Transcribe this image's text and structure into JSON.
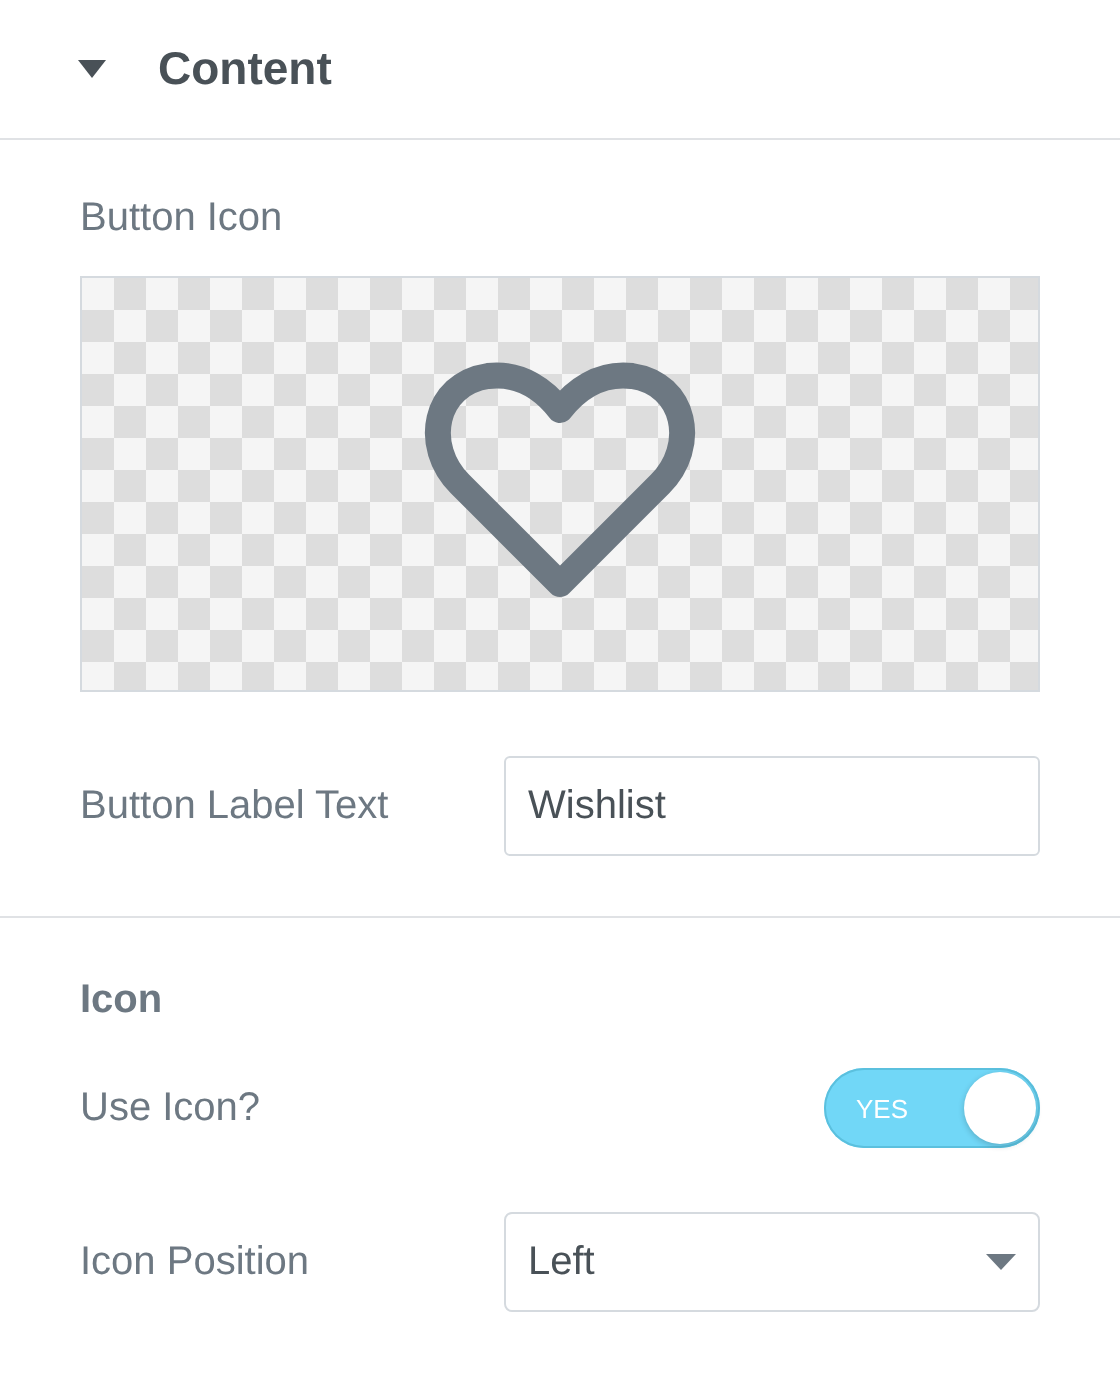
{
  "section": {
    "title": "Content",
    "expanded": true
  },
  "button_icon": {
    "label": "Button Icon"
  },
  "label_text": {
    "label": "Button Label Text",
    "value": "Wishlist"
  },
  "icon_section": {
    "heading": "Icon",
    "use_icon": {
      "label": "Use Icon?",
      "on": true,
      "on_text": "YES"
    },
    "position": {
      "label": "Icon Position",
      "value": "Left"
    }
  }
}
